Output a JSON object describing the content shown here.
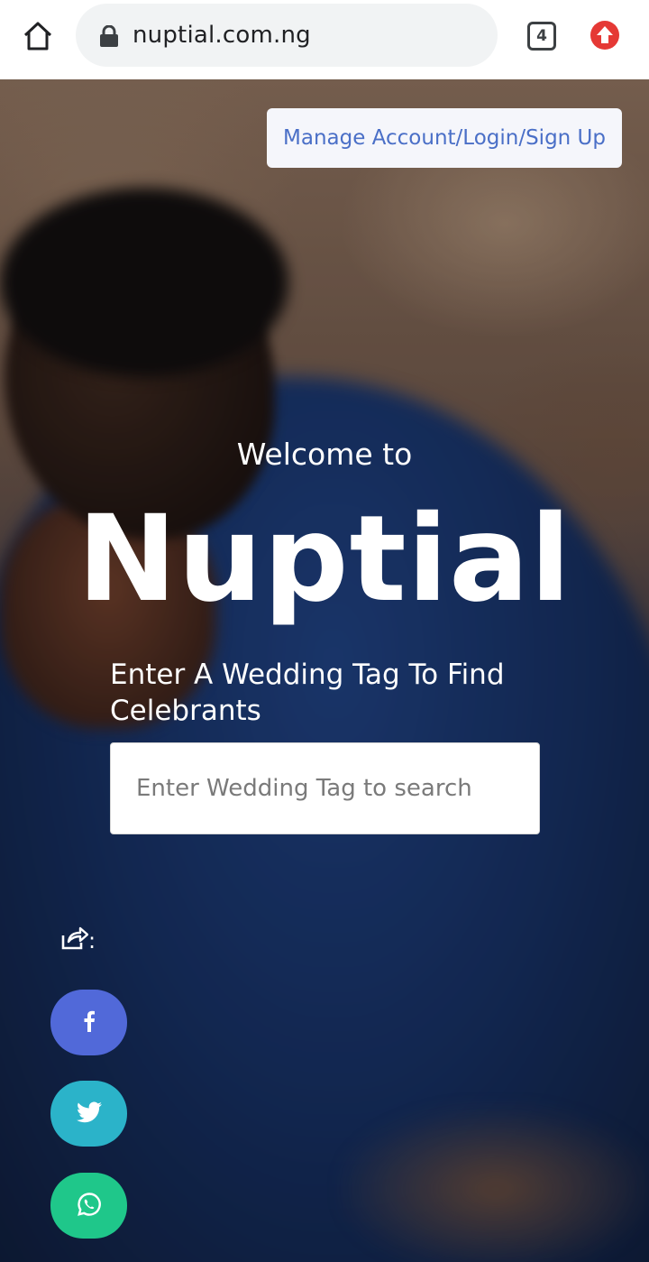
{
  "browser": {
    "url": "nuptial.com.ng",
    "tab_count": "4",
    "icons": {
      "home": "home-icon",
      "lock": "lock-icon",
      "tabs": "tab-switcher-icon",
      "update": "update-arrow-icon"
    },
    "colors": {
      "update": "#e53935"
    }
  },
  "hero": {
    "account_link": "Manage Account/Login/Sign Up",
    "welcome": "Welcome to",
    "brand": "Nuptial",
    "prompt": "Enter A Wedding Tag To Find Celebrants",
    "search": {
      "placeholder": "Enter Wedding Tag to search",
      "value": ""
    }
  },
  "share": {
    "label": ":",
    "icon": "share-icon",
    "buttons": [
      {
        "name": "facebook",
        "icon": "facebook-icon",
        "color": "#5169d9"
      },
      {
        "name": "twitter",
        "icon": "twitter-icon",
        "color": "#2bb3c9"
      },
      {
        "name": "whatsapp",
        "icon": "whatsapp-icon",
        "color": "#1fc78a"
      }
    ]
  }
}
